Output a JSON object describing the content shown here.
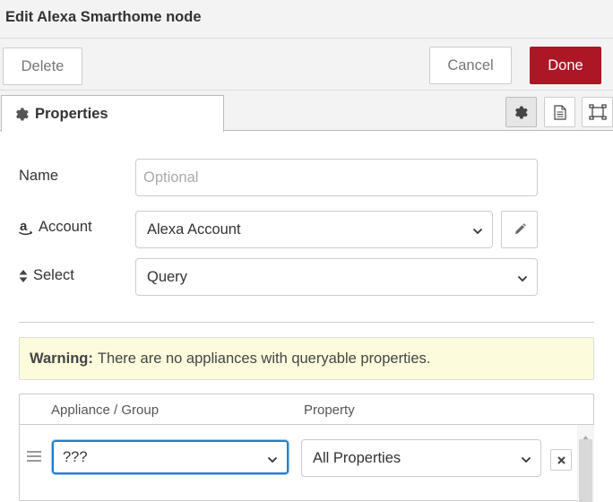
{
  "window": {
    "title": "Edit Alexa Smarthome node"
  },
  "toolbar": {
    "delete_label": "Delete",
    "cancel_label": "Cancel",
    "done_label": "Done"
  },
  "tabs": {
    "properties_label": "Properties",
    "icons": [
      "gear-icon",
      "document-icon",
      "frame-icon"
    ]
  },
  "form": {
    "name": {
      "label": "Name",
      "placeholder": "Optional",
      "value": ""
    },
    "account": {
      "label": "Account",
      "value": "Alexa Account"
    },
    "select": {
      "label": "Select",
      "value": "Query"
    }
  },
  "warning": {
    "strong": "Warning:",
    "text": "There are no appliances with queryable properties."
  },
  "table": {
    "headers": {
      "appliance": "Appliance / Group",
      "property": "Property"
    },
    "rows": [
      {
        "appliance": "???",
        "property": "All Properties"
      }
    ]
  },
  "colors": {
    "accent": "#ad1625",
    "warning_bg": "#fcfcdd",
    "focus": "#1f7fd1"
  }
}
